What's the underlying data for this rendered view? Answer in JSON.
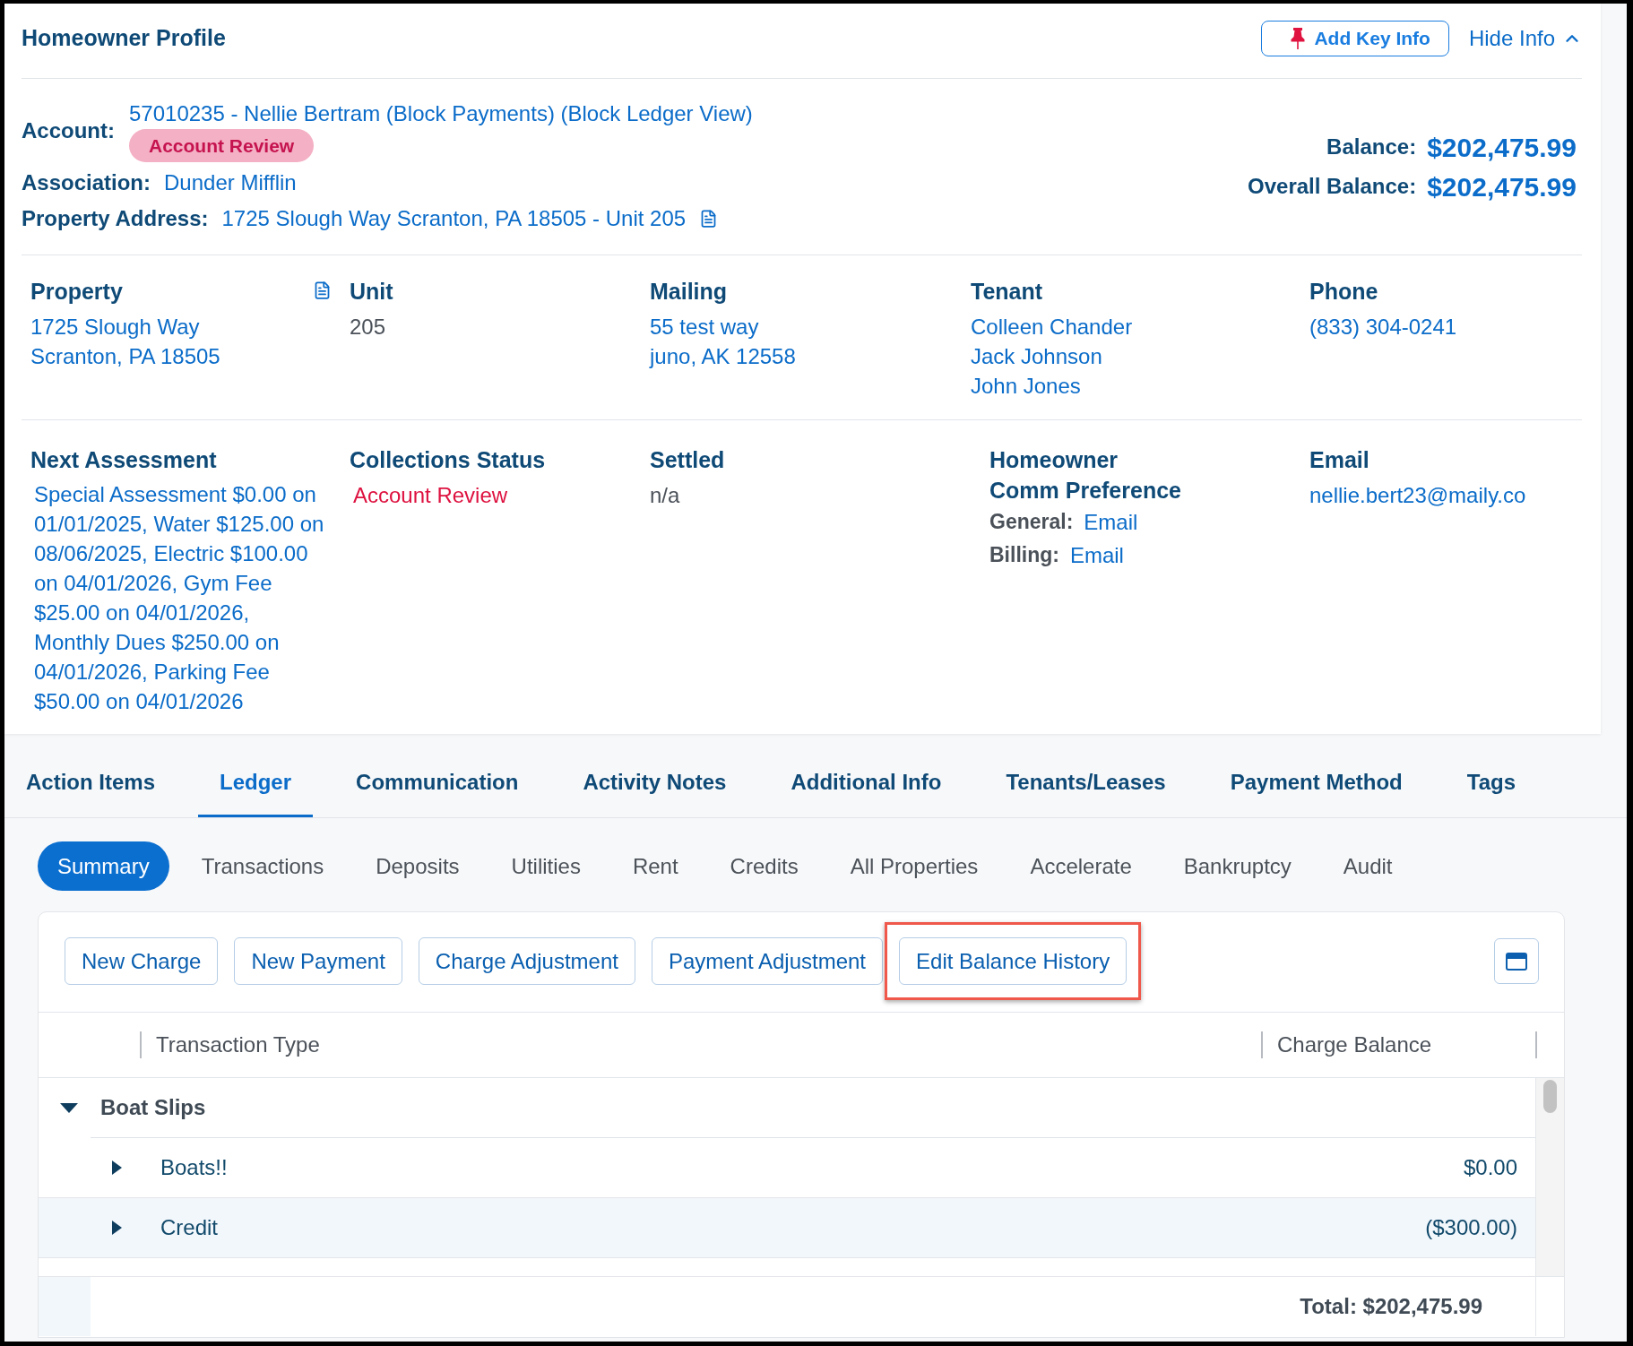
{
  "profile": {
    "title": "Homeowner Profile",
    "add_key_info": "Add Key Info",
    "hide_info": "Hide Info",
    "account": {
      "label": "Account:",
      "value": "57010235 - Nellie Bertram (Block Payments) (Block Ledger View)",
      "badge": "Account Review"
    },
    "fields": [
      {
        "label": "Association:",
        "value": "Dunder Mifflin"
      },
      {
        "label": "Property Address:",
        "value": "1725 Slough Way Scranton, PA 18505 - Unit 205",
        "doc_icon": true
      }
    ],
    "balances": [
      {
        "label": "Balance:",
        "value": "$202,475.99"
      },
      {
        "label": "Overall Balance:",
        "value": "$202,475.99"
      }
    ],
    "details": [
      [
        {
          "kind": "link",
          "heading": [
            "Property"
          ],
          "doc_icon": true,
          "lines": [
            "1725 Slough Way",
            "Scranton, PA 18505"
          ]
        },
        {
          "kind": "text",
          "heading": [
            "Unit"
          ],
          "lines": [
            "205"
          ]
        },
        {
          "kind": "link",
          "heading": [
            "Mailing"
          ],
          "lines": [
            "55 test way",
            "juno, AK 12558"
          ]
        },
        {
          "kind": "link",
          "heading": [
            "Tenant"
          ],
          "lines": [
            "Colleen Chander",
            "Jack Johnson",
            "John Jones"
          ]
        },
        {
          "kind": "link",
          "heading": [
            "Phone"
          ],
          "lines": [
            "(833) 304-0241"
          ]
        }
      ],
      [
        {
          "kind": "paragraph",
          "heading": [
            "Next Assessment"
          ],
          "text": "Special Assessment $0.00 on 01/01/2025, Water $125.00 on 08/06/2025, Electric $100.00 on 04/01/2026, Gym Fee $25.00 on 04/01/2026, Monthly Dues $250.00 on 04/01/2026, Parking Fee $50.00 on 04/01/2026"
        },
        {
          "kind": "alert",
          "heading": [
            "Collections Status"
          ],
          "lines": [
            "Account Review"
          ]
        },
        {
          "kind": "text",
          "heading": [
            "Settled"
          ],
          "lines": [
            "n/a"
          ]
        },
        {
          "kind": "prefs",
          "heading": [
            "Homeowner",
            "Comm Preference"
          ],
          "prefs": [
            {
              "label": "General:",
              "value": "Email"
            },
            {
              "label": "Billing:",
              "value": "Email"
            }
          ]
        },
        {
          "kind": "link",
          "heading": [
            "Email"
          ],
          "lines": [
            "nellie.bert23@maily.co"
          ]
        }
      ]
    ]
  },
  "tabs": [
    {
      "label": "Action Items",
      "selected": false
    },
    {
      "label": "Ledger",
      "selected": true
    },
    {
      "label": "Communication",
      "selected": false
    },
    {
      "label": "Activity Notes",
      "selected": false
    },
    {
      "label": "Additional Info",
      "selected": false
    },
    {
      "label": "Tenants/Leases",
      "selected": false
    },
    {
      "label": "Payment Method",
      "selected": false
    },
    {
      "label": "Tags",
      "selected": false
    }
  ],
  "subtabs": [
    {
      "label": "Summary",
      "selected": true
    },
    {
      "label": "Transactions",
      "selected": false
    },
    {
      "label": "Deposits",
      "selected": false
    },
    {
      "label": "Utilities",
      "selected": false
    },
    {
      "label": "Rent",
      "selected": false
    },
    {
      "label": "Credits",
      "selected": false
    },
    {
      "label": "All Properties",
      "selected": false
    },
    {
      "label": "Accelerate",
      "selected": false
    },
    {
      "label": "Bankruptcy",
      "selected": false
    },
    {
      "label": "Audit",
      "selected": false
    }
  ],
  "toolbar": {
    "buttons": [
      {
        "label": "New Charge",
        "highlighted": false
      },
      {
        "label": "New Payment",
        "highlighted": false
      },
      {
        "label": "Charge Adjustment",
        "highlighted": false
      },
      {
        "label": "Payment Adjustment",
        "highlighted": false
      },
      {
        "label": "Edit Balance History",
        "highlighted": true
      }
    ]
  },
  "table": {
    "columns": [
      "Transaction Type",
      "Charge Balance"
    ],
    "groups": [
      {
        "label": "Boat Slips",
        "expanded": true,
        "rows": [
          {
            "label": "Boats!!",
            "value": "$0.00",
            "expanded": false,
            "highlighted": false
          },
          {
            "label": "Credit",
            "value": "($300.00)",
            "expanded": false,
            "highlighted": true
          }
        ]
      }
    ],
    "total": "Total: $202,475.99"
  }
}
